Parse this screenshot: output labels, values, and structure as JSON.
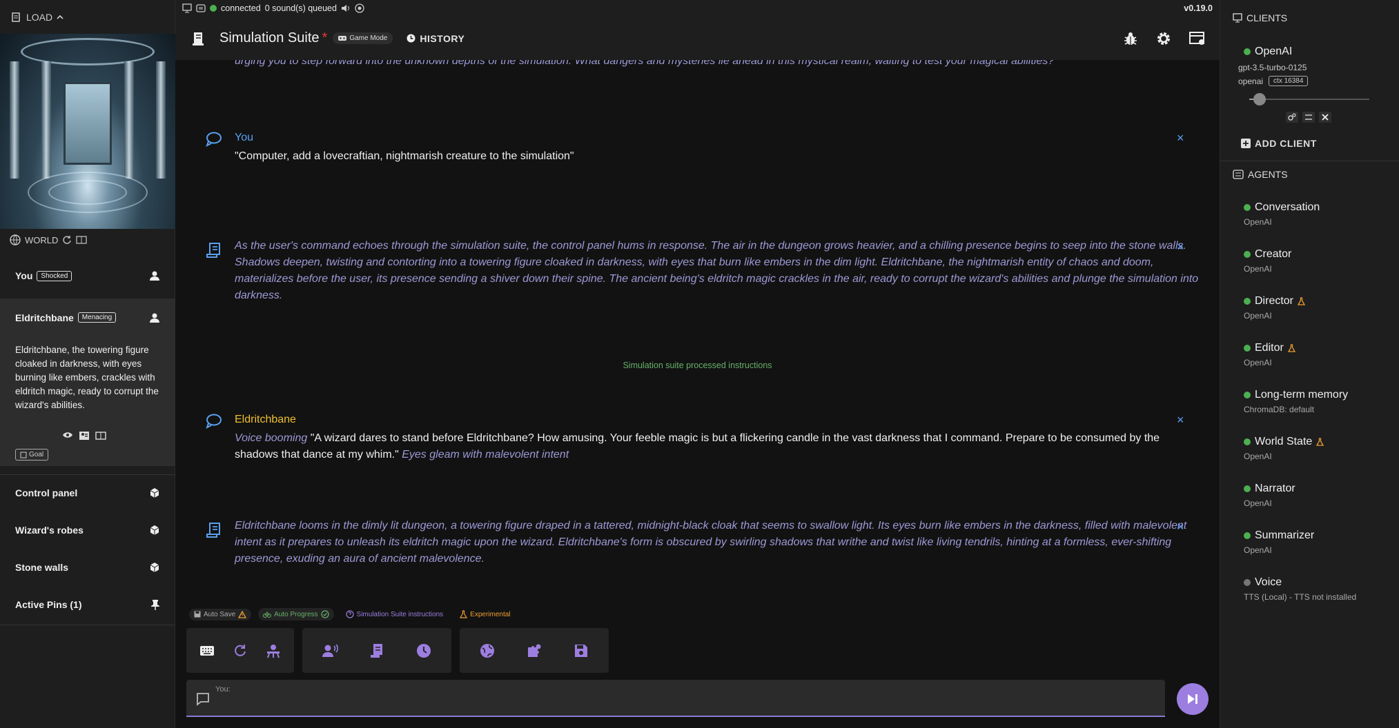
{
  "left": {
    "load_label": "LOAD",
    "world_label": "WORLD",
    "characters": [
      {
        "name": "You",
        "badge": "Shocked"
      },
      {
        "name": "Eldritchbane",
        "badge": "Menacing"
      }
    ],
    "selected_description": "Eldritchbane, the towering figure cloaked in darkness, with eyes burning like embers, crackles with eldritch magic, ready to corrupt the wizard's abilities.",
    "goal_label": "Goal",
    "objects": [
      "Control panel",
      "Wizard's robes",
      "Stone walls"
    ],
    "active_pins": "Active Pins (1)"
  },
  "status": {
    "connected": "connected",
    "queue": "0 sound(s) queued",
    "version": "v0.19.0"
  },
  "header": {
    "title": "Simulation Suite",
    "modified_marker": "*",
    "game_mode": "Game Mode",
    "history": "HISTORY"
  },
  "chat": {
    "top_fragment": "urging you to step forward into the unknown depths of the simulation. What dangers and mysteries lie ahead in this mystical realm, waiting to test your magical abilities?",
    "m1_who": "You",
    "m1_text": "\"Computer, add a lovecraftian, nightmarish creature to the simulation\"",
    "m2_text": "As the user's command echoes through the simulation suite, the control panel hums in response. The air in the dungeon grows heavier, and a chilling presence begins to seep into the stone walls. Shadows deepen, twisting and contorting into a towering figure cloaked in darkness, with eyes that burn like embers in the dim light. Eldritchbane, the nightmarish entity of chaos and doom, materializes before the user, its presence sending a shiver down their spine. The ancient being's eldritch magic crackles in the air, ready to corrupt the wizard's abilities and plunge the simulation into darkness.",
    "system_text": "Simulation suite processed instructions",
    "m3_who": "Eldritchbane",
    "m3_action1": "Voice booming",
    "m3_speech": " \"A wizard dares to stand before Eldritchbane? How amusing. Your feeble magic is but a flickering candle in the vast darkness that I command. Prepare to be consumed by the shadows that dance at my whim.\" ",
    "m3_action2": "Eyes gleam with malevolent intent",
    "m4_text": "Eldritchbane looms in the dimly lit dungeon, a towering figure draped in a tattered, midnight-black cloak that seems to swallow light. Its eyes burn like embers in the darkness, filled with malevolent intent as it prepares to unleash its eldritch magic upon the wizard. Eldritchbane's form is obscured by swirling shadows that writhe and twist like living tendrils, hinting at a formless, ever-shifting presence, exuding an aura of ancient malevolence.",
    "close_glyph": "×"
  },
  "statusbar": {
    "auto_save": "Auto Save",
    "auto_progress": "Auto Progress",
    "instructions": "Simulation Suite instructions",
    "experimental": "Experimental"
  },
  "input": {
    "label": "You:"
  },
  "right": {
    "clients_title": "CLIENTS",
    "client_name": "OpenAI",
    "client_model": "gpt-3.5-turbo-0125",
    "client_type": "openai",
    "client_ctx": "ctx 16384",
    "add_client": "ADD CLIENT",
    "agents_title": "AGENTS",
    "agents": [
      {
        "name": "Conversation",
        "sub": "OpenAI"
      },
      {
        "name": "Creator",
        "sub": "OpenAI"
      },
      {
        "name": "Director",
        "sub": "OpenAI"
      },
      {
        "name": "Editor",
        "sub": "OpenAI"
      },
      {
        "name": "Long-term memory",
        "sub": "ChromaDB: default"
      },
      {
        "name": "World State",
        "sub": "OpenAI"
      },
      {
        "name": "Narrator",
        "sub": "OpenAI"
      },
      {
        "name": "Summarizer",
        "sub": "OpenAI"
      },
      {
        "name": "Voice",
        "sub": "TTS (Local) - TTS not installed"
      }
    ]
  },
  "colors": {
    "accent": "#9c7ee0",
    "narration": "#9d99d6",
    "link_blue": "#5aa0f0",
    "status_green": "#4caf50",
    "warning_orange": "#f0a030"
  }
}
